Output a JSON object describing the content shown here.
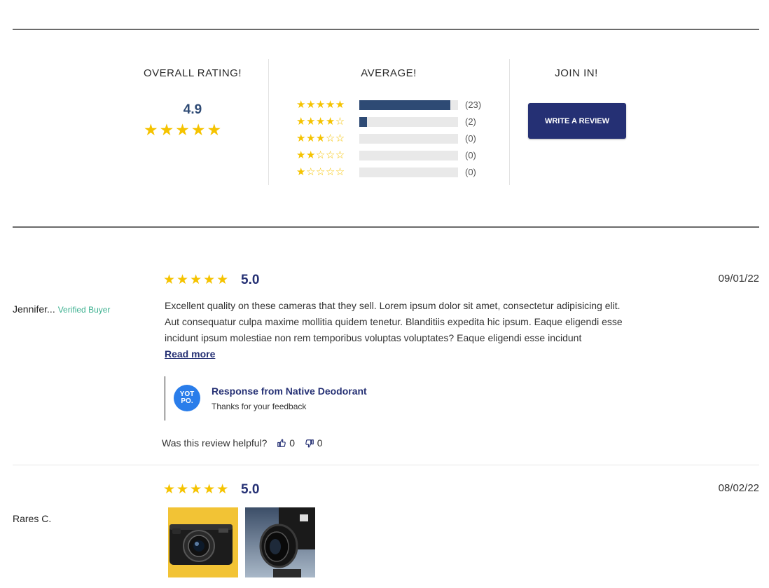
{
  "summary": {
    "overall_title": "OVERALL RATING!",
    "overall_score": "4.9",
    "overall_stars": "★★★★★",
    "average_title": "AVERAGE!",
    "distribution": [
      {
        "stars": "★★★★★",
        "count_label": "(23)",
        "fraction": 0.92
      },
      {
        "stars": "★★★★☆",
        "count_label": "(2)",
        "fraction": 0.08
      },
      {
        "stars": "★★★☆☆",
        "count_label": "(0)",
        "fraction": 0
      },
      {
        "stars": "★★☆☆☆",
        "count_label": "(0)",
        "fraction": 0
      },
      {
        "stars": "★☆☆☆☆",
        "count_label": "(0)",
        "fraction": 0
      }
    ],
    "join_title": "JOIN IN!",
    "write_review_label": "WRITE A REVIEW"
  },
  "reviews": [
    {
      "reviewer": "Jennifer...",
      "badge": "Verified Buyer",
      "stars": "★★★★★",
      "score": "5.0",
      "date": "09/01/22",
      "text_lines": [
        "Excellent quality on these cameras that they sell. Lorem ipsum dolor sit amet, consectetur adipisicing elit.",
        "Aut consequatur culpa maxime mollitia quidem tenetur. Blanditiis expedita hic ipsum. Eaque eligendi esse",
        "incidunt ipsum molestiae non rem temporibus voluptas voluptates?  Eaque eligendi esse incidunt"
      ],
      "read_more": "Read more",
      "response": {
        "logo_text": "YOT PO.",
        "title": "Response from Native Deodorant",
        "text": "Thanks for your feedback"
      },
      "helpful_label": "Was this review helpful?",
      "thumbs_up_count": "0",
      "thumbs_down_count": "0"
    },
    {
      "reviewer": "Rares C.",
      "stars": "★★★★★",
      "score": "5.0",
      "date": "08/02/22",
      "images": [
        "camera-photo-yellow",
        "camera-lens-photo"
      ]
    }
  ],
  "colors": {
    "star": "#f5c300",
    "brand": "#253074",
    "bar": "#2e4a74",
    "verified": "#3bb08f",
    "yotpo": "#2a7dea"
  }
}
